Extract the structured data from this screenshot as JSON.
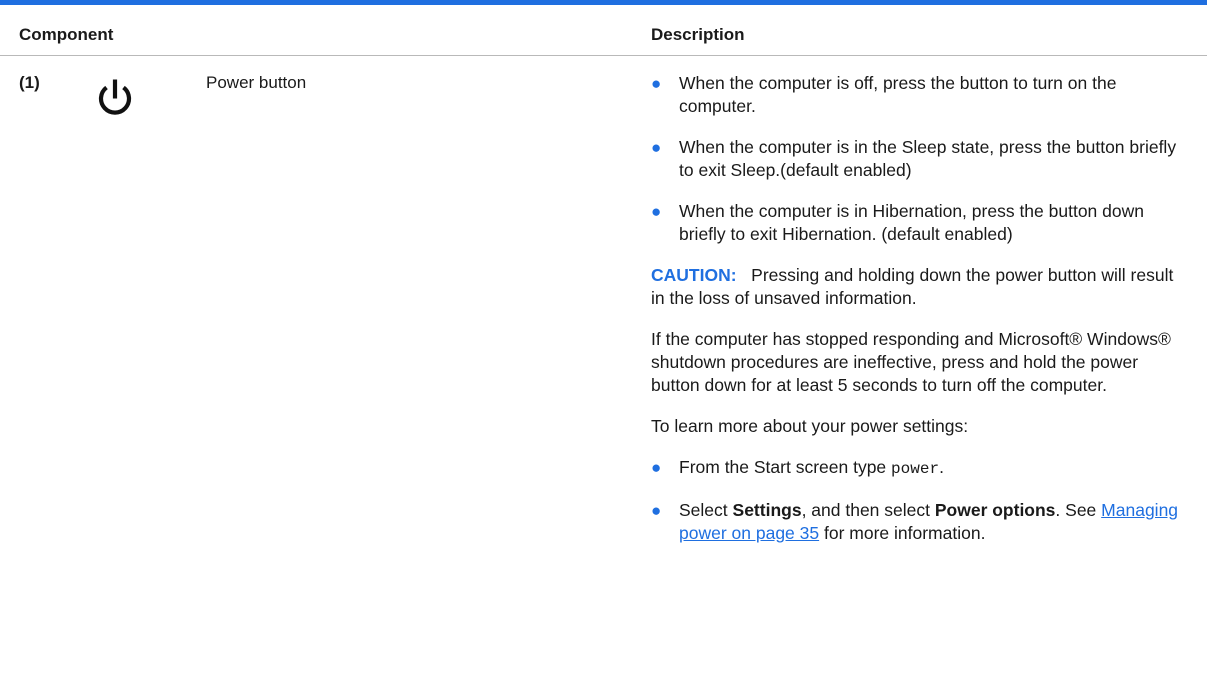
{
  "table": {
    "headers": {
      "component": "Component",
      "description": "Description"
    },
    "row": {
      "number": "(1)",
      "icon": "power-icon",
      "name": "Power button"
    }
  },
  "description": {
    "bullets_top": [
      "When the computer is off, press the button to turn on the computer.",
      "When the computer is in the Sleep state, press the button briefly to exit Sleep.(default enabled)",
      "When the computer is in Hibernation, press the button down briefly to exit Hibernation. (default enabled)"
    ],
    "caution_label": "CAUTION:",
    "caution_text": "Pressing and holding down the power button will result in the loss of unsaved information.",
    "paragraph1": "If the computer has stopped responding and Microsoft® Windows® shutdown procedures are ineffective, press and hold the power button down for at least 5 seconds to turn off the computer.",
    "paragraph2": "To learn more about your power settings:",
    "bullet_start": {
      "prefix": "From the Start screen type",
      "code": "power",
      "suffix": "."
    },
    "bullet_settings": {
      "part1": "Select",
      "settings": "Settings",
      "part2": ", and then select",
      "power_options": "Power options",
      "part3": ". See",
      "link": "Managing power on page 35",
      "part4": "for more information."
    }
  },
  "colors": {
    "accent": "#1f6fe0",
    "text": "#1a1a1a",
    "rule": "#b9b9b9"
  }
}
